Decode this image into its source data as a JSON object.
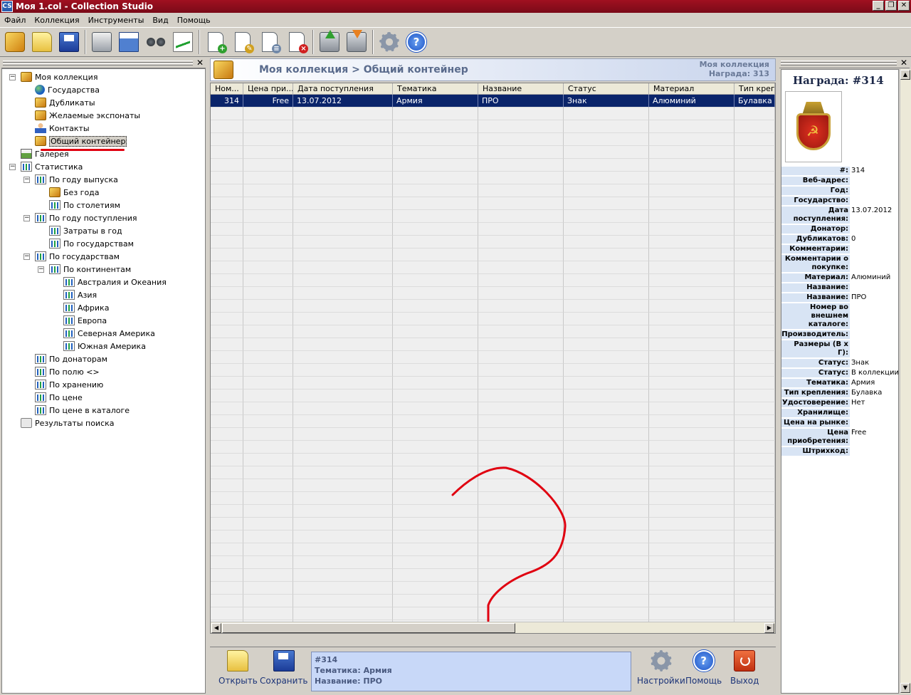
{
  "window": {
    "title": "Моя 1.col - Collection Studio",
    "app_icon": "CS",
    "btn_minimize": "_",
    "btn_restore": "❐",
    "btn_close": "✕"
  },
  "menu": [
    "Файл",
    "Коллекция",
    "Инструменты",
    "Вид",
    "Помощь"
  ],
  "toolbar_icons": [
    "collection-book-icon",
    "open-folder-icon",
    "save-disk-icon",
    "print-icon",
    "window-icon",
    "binoculars-icon",
    "chart-icon",
    "new-item-icon",
    "edit-item-icon",
    "copy-item-icon",
    "delete-item-icon",
    "upload-icon",
    "download-icon",
    "settings-gear-icon",
    "help-icon"
  ],
  "tree": {
    "items": [
      {
        "label": "Моя коллекция"
      },
      {
        "label": "Государства"
      },
      {
        "label": "Дубликаты"
      },
      {
        "label": "Желаемые экспонаты"
      },
      {
        "label": "Контакты"
      },
      {
        "label": "Общий контейнер"
      },
      {
        "label": "Галерея"
      },
      {
        "label": "Статистика"
      },
      {
        "label": "По году выпуска"
      },
      {
        "label": "Без года"
      },
      {
        "label": "По столетиям"
      },
      {
        "label": "По году поступления"
      },
      {
        "label": "Затраты в год"
      },
      {
        "label": "По государствам"
      },
      {
        "label": "По государствам"
      },
      {
        "label": "По континентам"
      },
      {
        "label": "Австралия и Океания"
      },
      {
        "label": "Азия"
      },
      {
        "label": "Африка"
      },
      {
        "label": "Европа"
      },
      {
        "label": "Северная Америка"
      },
      {
        "label": "Южная Америка"
      },
      {
        "label": "По донаторам"
      },
      {
        "label": "По полю <>"
      },
      {
        "label": "По хранению"
      },
      {
        "label": "По цене"
      },
      {
        "label": "По цене в каталоге"
      },
      {
        "label": "Результаты поиска"
      }
    ]
  },
  "center": {
    "breadcrumb": "Моя коллекция  > Общий контейнер",
    "header_right_1": "Моя коллекция",
    "header_right_2": "Награда: 313",
    "columns": [
      "Ном...",
      "Цена при...",
      "Дата поступления",
      "Тематика",
      "Название",
      "Статус",
      "Материал",
      "Тип крепле"
    ],
    "rows": [
      [
        "314",
        "Free",
        "13.07.2012",
        "Армия",
        "ПРО",
        "Знак",
        "Алюминий",
        "Булавка"
      ]
    ]
  },
  "bottom": {
    "open_label": "Открыть",
    "save_label": "Сохранить",
    "info_line1": "#314",
    "info_line2": "Тематика: Армия",
    "info_line3": "Название: ПРО",
    "settings_label": "Настройки",
    "help_label": "Помощь",
    "exit_label": "Выход"
  },
  "details": {
    "title": "Награда: #314",
    "fields": [
      {
        "k": "#:",
        "v": "314"
      },
      {
        "k": "Веб-адрес:",
        "v": ""
      },
      {
        "k": "Год:",
        "v": ""
      },
      {
        "k": "Государство:",
        "v": ""
      },
      {
        "k": "Дата поступления:",
        "v": "13.07.2012"
      },
      {
        "k": "Донатор:",
        "v": ""
      },
      {
        "k": "Дубликатов:",
        "v": "0"
      },
      {
        "k": "Комментарии:",
        "v": ""
      },
      {
        "k": "Комментарии о покупке:",
        "v": ""
      },
      {
        "k": "Материал:",
        "v": "Алюминий"
      },
      {
        "k": "Название:",
        "v": ""
      },
      {
        "k": "Название:",
        "v": "ПРО"
      },
      {
        "k": "Номер во внешнем каталоге:",
        "v": ""
      },
      {
        "k": "Производитель:",
        "v": ""
      },
      {
        "k": "Размеры (В х Г):",
        "v": ""
      },
      {
        "k": "Статус:",
        "v": "Знак"
      },
      {
        "k": "Статус:",
        "v": "В коллекции"
      },
      {
        "k": "Тематика:",
        "v": "Армия"
      },
      {
        "k": "Тип крепления:",
        "v": "Булавка"
      },
      {
        "k": "Удостоверение:",
        "v": "Нет"
      },
      {
        "k": "Хранилище:",
        "v": ""
      },
      {
        "k": "Цена на рынке:",
        "v": ""
      },
      {
        "k": "Цена приобретения:",
        "v": "Free"
      },
      {
        "k": "Штрихкод:",
        "v": ""
      }
    ]
  },
  "colors": {
    "selection": "#0a246a",
    "annotation_red": "#e00010",
    "titlebar": "#a01020"
  }
}
